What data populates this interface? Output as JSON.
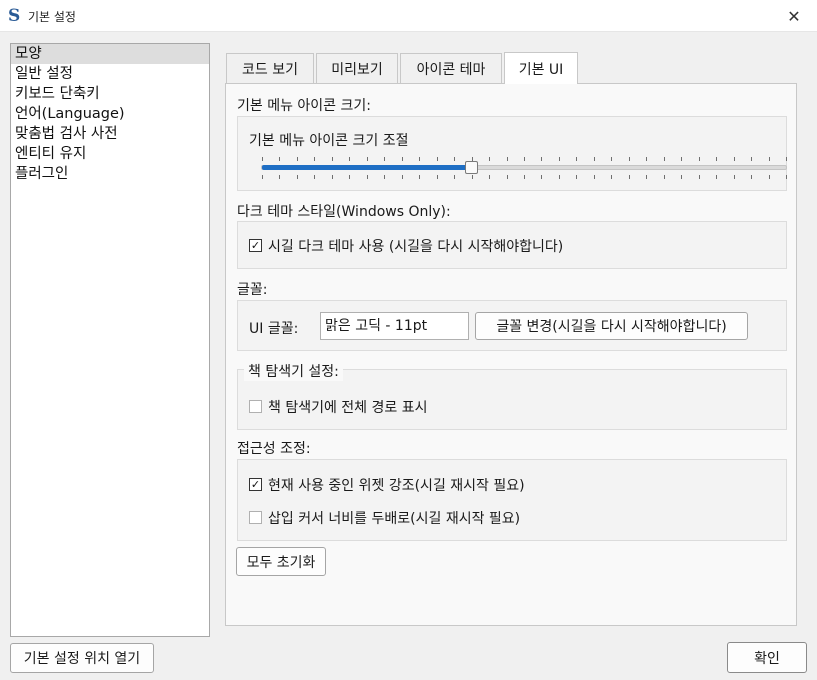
{
  "window": {
    "title": "기본 설정",
    "app_icon_glyph": "S",
    "close_glyph": "✕"
  },
  "sidebar": {
    "items": [
      {
        "label": "모양",
        "selected": true
      },
      {
        "label": "일반 설정",
        "selected": false
      },
      {
        "label": "키보드 단축키",
        "selected": false
      },
      {
        "label": "언어(Language)",
        "selected": false
      },
      {
        "label": "맞춤법 검사 사전",
        "selected": false
      },
      {
        "label": "엔티티 유지",
        "selected": false
      },
      {
        "label": "플러그인",
        "selected": false
      }
    ]
  },
  "tabs": [
    {
      "label": "코드 보기",
      "active": false
    },
    {
      "label": "미리보기",
      "active": false
    },
    {
      "label": "아이콘 테마",
      "active": false
    },
    {
      "label": "기본 UI",
      "active": true
    }
  ],
  "menu_icon": {
    "section_label": "기본 메뉴 아이콘 크기:",
    "slider_label": "기본 메뉴 아이콘 크기 조절",
    "slider_value_fraction": 0.4
  },
  "dark_theme": {
    "section_label": "다크 테마 스타일(Windows Only):",
    "checkbox_label": "시길 다크 테마 사용  (시길을 다시 시작해야합니다)",
    "checked": true
  },
  "font": {
    "section_label": "글꼴:",
    "ui_font_label": "UI 글꼴:",
    "ui_font_value": "맑은 고딕 - 11pt",
    "change_button": "글꼴 변경(시길을 다시 시작해야합니다)"
  },
  "book_browser": {
    "legend": "책 탐색기 설정:",
    "checkbox_label": "책 탐색기에 전체 경로 표시",
    "checked": false
  },
  "accessibility": {
    "section_label": "접근성 조정:",
    "highlight_label": "현재 사용 중인 위젯 강조(시길 재시작 필요)",
    "highlight_checked": true,
    "caret_label": "삽입 커서 너비를 두배로(시길 재시작 필요)",
    "caret_checked": false
  },
  "buttons": {
    "reset": "모두 초기화",
    "open_location": "기본 설정 위치 열기",
    "ok": "확인"
  },
  "colors": {
    "accent": "#1e6ec4",
    "selected_item_bg": "#dddddd"
  }
}
